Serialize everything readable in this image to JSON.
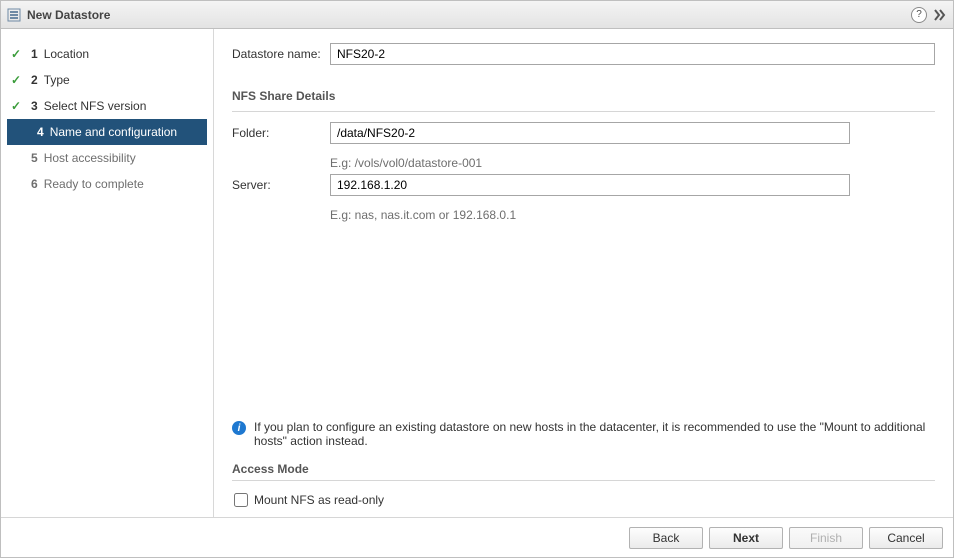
{
  "titlebar": {
    "title": "New Datastore"
  },
  "steps": {
    "s1": {
      "num": "1",
      "label": "Location"
    },
    "s2": {
      "num": "2",
      "label": "Type"
    },
    "s3": {
      "num": "3",
      "label": "Select NFS version"
    },
    "s4": {
      "num": "4",
      "label": "Name and configuration"
    },
    "s5": {
      "num": "5",
      "label": "Host accessibility"
    },
    "s6": {
      "num": "6",
      "label": "Ready to complete"
    }
  },
  "form": {
    "datastore_name_label": "Datastore name:",
    "datastore_name_value": "NFS20-2",
    "nfs_details_title": "NFS Share Details",
    "folder_label": "Folder:",
    "folder_value": "/data/NFS20-2",
    "folder_hint": "E.g: /vols/vol0/datastore-001",
    "server_label": "Server:",
    "server_value": "192.168.1.20",
    "server_hint": "E.g: nas, nas.it.com or 192.168.0.1"
  },
  "info": {
    "text": "If you plan to configure an existing datastore on new hosts in the datacenter, it is recommended to use the \"Mount to additional hosts\" action instead."
  },
  "access": {
    "title": "Access Mode",
    "readonly_label": "Mount NFS as read-only"
  },
  "footer": {
    "back": "Back",
    "next": "Next",
    "finish": "Finish",
    "cancel": "Cancel"
  }
}
